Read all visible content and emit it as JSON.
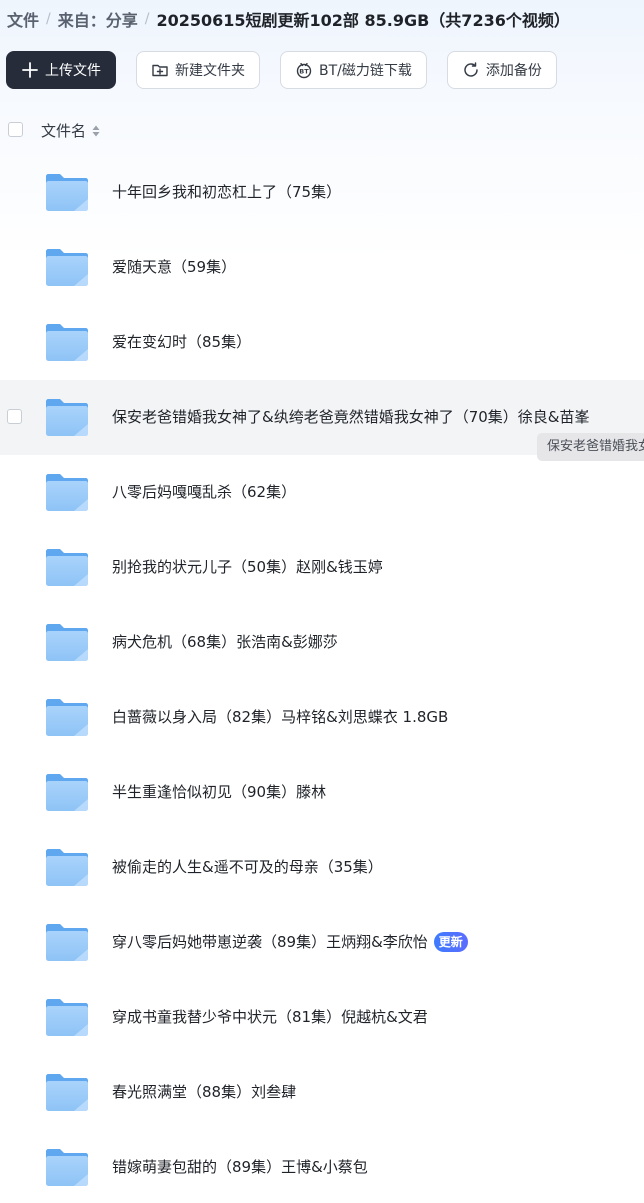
{
  "breadcrumb": {
    "root": "文件",
    "source": "来自：分享",
    "current": "20250615短剧更新102部 85.9GB（共7236个视频）",
    "separator": "/"
  },
  "toolbar": {
    "upload_label": "上传文件",
    "new_folder_label": "新建文件夹",
    "bt_label": "BT/磁力链下载",
    "backup_label": "添加备份"
  },
  "list_header": {
    "name_column": "文件名"
  },
  "files": [
    {
      "name": "十年回乡我和初恋杠上了（75集）"
    },
    {
      "name": "爱随天意（59集）"
    },
    {
      "name": "爱在变幻时（85集）"
    },
    {
      "name": "保安老爸错婚我女神了&纨绔老爸竟然错婚我女神了（70集）徐良&苗峯"
    },
    {
      "name": "八零后妈嘎嘎乱杀（62集）"
    },
    {
      "name": "别抢我的状元儿子（50集）赵刚&钱玉婷"
    },
    {
      "name": "病犬危机（68集）张浩南&彭娜莎"
    },
    {
      "name": "白蔷薇以身入局（82集）马梓铭&刘思蝶衣 1.8GB"
    },
    {
      "name": "半生重逢恰似初见（90集）滕林"
    },
    {
      "name": "被偷走的人生&遥不可及的母亲（35集）"
    },
    {
      "name": "穿八零后妈她带崽逆袭（89集）王炳翔&李欣怡",
      "badge": "更新"
    },
    {
      "name": "穿成书童我替少爷中状元（81集）倪越杭&文君"
    },
    {
      "name": "春光照满堂（88集）刘叁肆"
    },
    {
      "name": "错嫁萌妻包甜的（89集）王博&小蔡包"
    }
  ],
  "hovered_row": 3,
  "tooltip": {
    "text": "保安老爸错婚我女"
  },
  "colors": {
    "primary_button": "#262c3a",
    "folder": "#7ab8f5",
    "badge": "#3d7bff",
    "hover_row": "#f3f4f6"
  }
}
